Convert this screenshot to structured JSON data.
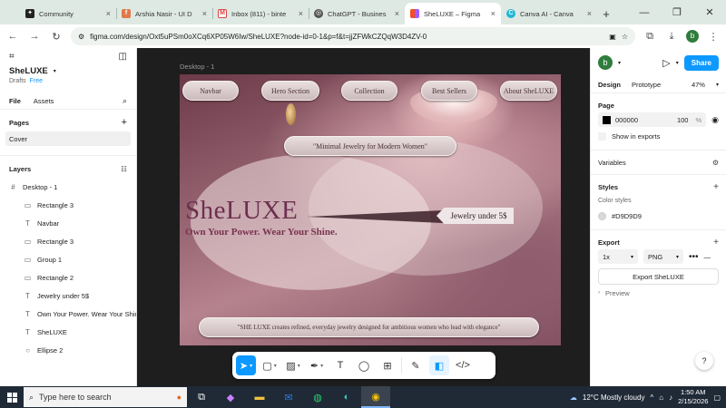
{
  "browser": {
    "tabs": [
      {
        "title": "Community",
        "icon": "community-icon",
        "active": false
      },
      {
        "title": "Arshia Nasir - UI D",
        "icon": "fiverr-icon",
        "active": false
      },
      {
        "title": "Inbox (811) - binte",
        "icon": "gmail-icon",
        "active": false
      },
      {
        "title": "ChatGPT - Busines",
        "icon": "chatgpt-icon",
        "active": false
      },
      {
        "title": "SheLUXE – Figma",
        "icon": "figma-icon",
        "active": true
      },
      {
        "title": "Canva AI - Canva",
        "icon": "canva-icon",
        "active": false
      }
    ],
    "url": "figma.com/design/Oxt5uPSm0oXCq6XP05W6Iw/SheLUXE?node-id=0-1&p=f&t=jjZFWkCZQqW3D4ZV-0",
    "profile_initial": "b"
  },
  "left_panel": {
    "project_name": "SheLUXE",
    "drafts": "Drafts",
    "plan": "Free",
    "tabs": [
      "File",
      "Assets"
    ],
    "pages_heading": "Pages",
    "pages": [
      "Cover"
    ],
    "layers_heading": "Layers",
    "frame": "Desktop - 1",
    "layers": [
      {
        "name": "Rectangle 3",
        "icon": "rectangle-icon"
      },
      {
        "name": "Navbar",
        "icon": "text-icon"
      },
      {
        "name": "Rectangle 3",
        "icon": "rectangle-icon"
      },
      {
        "name": "Group 1",
        "icon": "rectangle-icon"
      },
      {
        "name": "Rectangle 2",
        "icon": "rectangle-icon"
      },
      {
        "name": "Jewelry under 5$",
        "icon": "text-icon"
      },
      {
        "name": "Own Your Power. Wear Your Shine.",
        "icon": "text-icon"
      },
      {
        "name": "SheLUXE",
        "icon": "text-icon"
      },
      {
        "name": "Ellipse 2",
        "icon": "ellipse-icon"
      }
    ]
  },
  "canvas": {
    "frame_label": "Desktop - 1",
    "nav_items": [
      "Navbar",
      "Hero Section",
      "Collection",
      "Best Sellers",
      "About SheLUXE"
    ],
    "tagline": "\"Minimal Jewelry for Modern Women\"",
    "brand": "SheLUXE",
    "slogan": "Own Your Power. Wear Your Shine.",
    "price_tag": "Jewelry under 5$",
    "description": "\"SHE LUXE creates refined, everyday jewelry designed for ambitious women who lead with elegance\""
  },
  "toolbar": {
    "tools": [
      "move-tool",
      "frame-tool",
      "shape-tool",
      "pen-tool",
      "text-tool",
      "comment-tool",
      "actions-tool",
      "draw-mode",
      "dev-mode",
      "code-mode"
    ]
  },
  "right_panel": {
    "avatar_initial": "b",
    "share": "Share",
    "tabs": [
      "Design",
      "Prototype"
    ],
    "zoom": "47%",
    "page": {
      "heading": "Page",
      "color": "000000",
      "opacity": "100",
      "unit": "%",
      "show_exports": "Show in exports"
    },
    "variables": "Variables",
    "styles": {
      "heading": "Styles",
      "sub": "Color styles",
      "swatch": "#D9D9D9"
    },
    "export": {
      "heading": "Export",
      "scale": "1x",
      "format": "PNG",
      "button": "Export SheLUXE",
      "preview": "Preview"
    },
    "help": "?"
  },
  "taskbar": {
    "search_placeholder": "Type here to search",
    "weather": "12°C  Mostly cloudy",
    "time": "1:50 AM",
    "date": "2/15/2026"
  },
  "colors": {
    "figma_blue": "#0d99ff",
    "brand_plum": "#6d2f4e",
    "canvas_bg": "#1e1e1e"
  }
}
